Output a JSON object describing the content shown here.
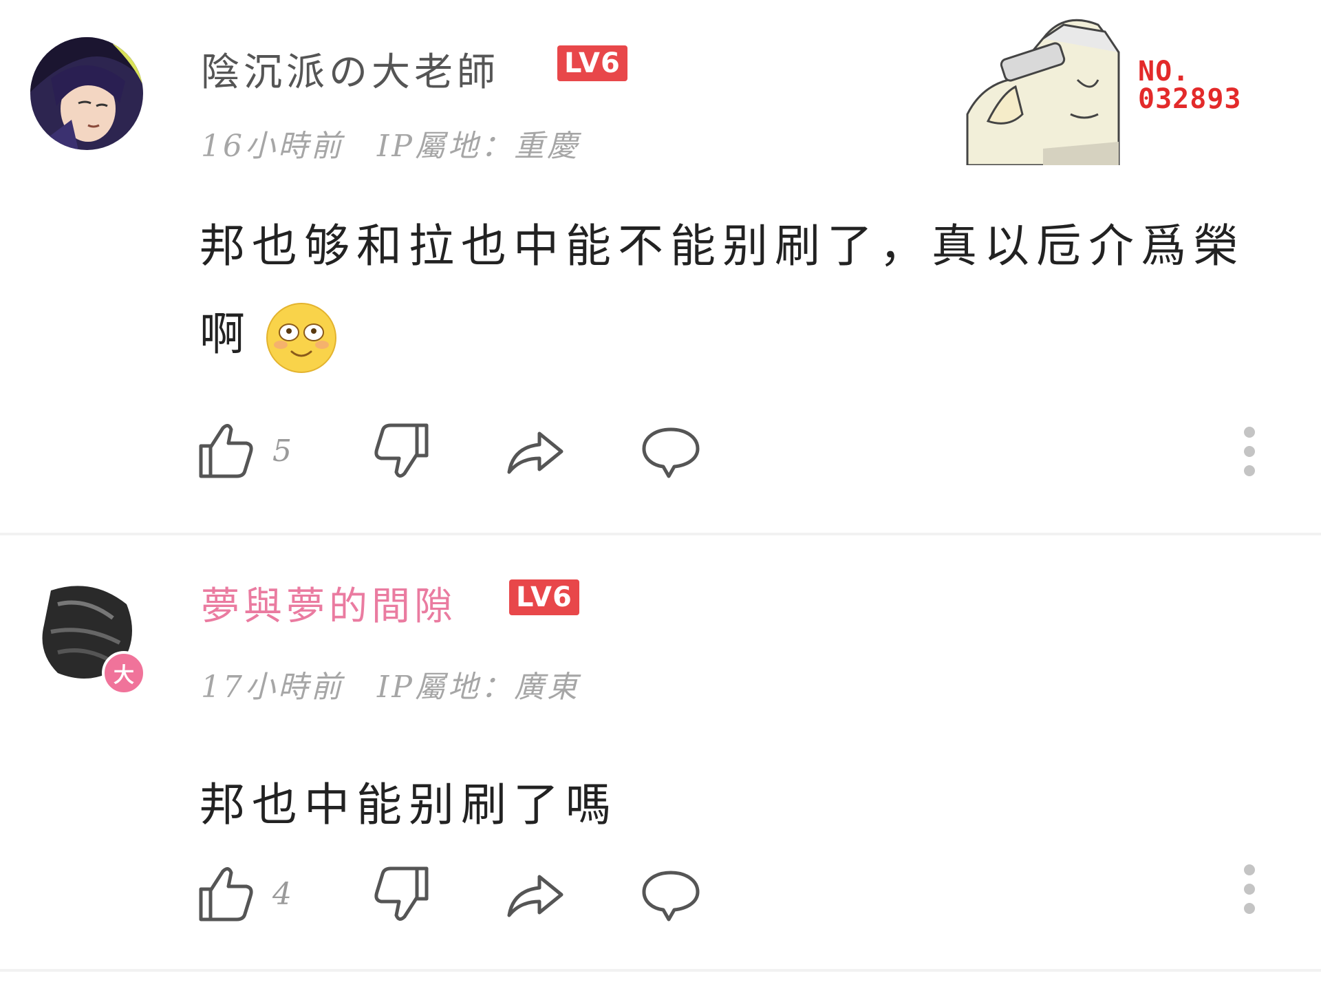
{
  "comments": [
    {
      "username": "陰沉派の大老師",
      "level": "LV6",
      "time": "16小時前",
      "ip_location": "IP屬地：重慶",
      "text": "邦也够和拉也中能不能别刷了，真以卮介爲榮啊",
      "emoji": "flushed-smile-emoji",
      "likes": "5",
      "sticker": {
        "label_top": "NO.",
        "label_num": "032893"
      }
    },
    {
      "username": "夢與夢的間隙",
      "level": "LV6",
      "time": "17小時前",
      "ip_location": "IP屬地：廣東",
      "text": "邦也中能别刷了嗎",
      "avatar_badge": "大",
      "likes": "4"
    }
  ],
  "colors": {
    "username_default": "#555555",
    "username_vip": "#ea7ba0",
    "level_badge": "#e8474a",
    "meta_text": "#a6a6a6",
    "icon_stroke": "#555555"
  }
}
